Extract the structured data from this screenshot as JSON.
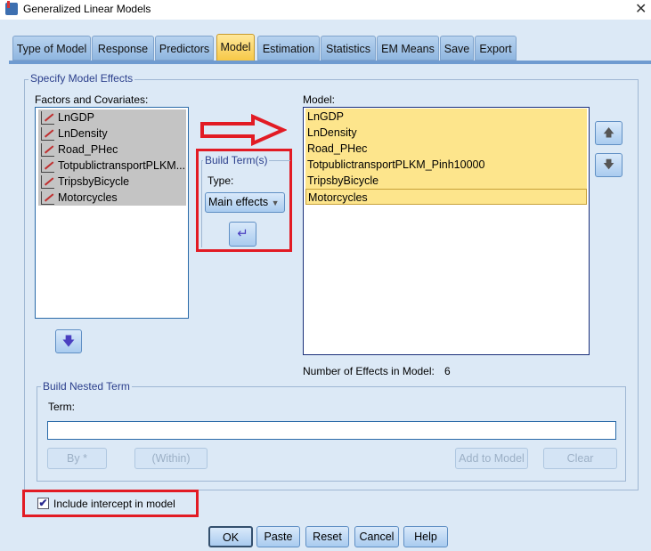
{
  "window": {
    "title": "Generalized Linear Models",
    "close_icon": "close-icon"
  },
  "tabs": [
    {
      "label": "Type of Model"
    },
    {
      "label": "Response"
    },
    {
      "label": "Predictors"
    },
    {
      "label": "Model",
      "active": true
    },
    {
      "label": "Estimation"
    },
    {
      "label": "Statistics"
    },
    {
      "label": "EM Means"
    },
    {
      "label": "Save"
    },
    {
      "label": "Export"
    }
  ],
  "specify": {
    "title": "Specify Model Effects",
    "factors_label": "Factors and Covariates:",
    "factors": [
      "LnGDP",
      "LnDensity",
      "Road_PHec",
      "TotpublictransportPLKM...",
      "TripsbyBicycle",
      "Motorcycles"
    ],
    "model_label": "Model:",
    "model": [
      "LnGDP",
      "LnDensity",
      "Road_PHec",
      "TotpublictransportPLKM_Pinh10000",
      "TripsbyBicycle",
      "Motorcycles"
    ],
    "selected_model_item": "Motorcycles",
    "build_term": {
      "title": "Build Term(s)",
      "type_label": "Type:",
      "type_value": "Main effects"
    },
    "effects_label": "Number of Effects in Model:",
    "effects_count": "6"
  },
  "nested": {
    "title": "Build Nested Term",
    "term_label": "Term:",
    "term_value": "",
    "by": "By *",
    "within": "(Within)",
    "add": "Add to Model",
    "clear": "Clear"
  },
  "intercept": {
    "label": "Include intercept in model",
    "checked": true
  },
  "buttons": {
    "ok": "OK",
    "paste": "Paste",
    "reset": "Reset",
    "cancel": "Cancel",
    "help": "Help"
  },
  "colors": {
    "highlight": "#e21b24",
    "model_item": "#fde58c",
    "active_tab": "#f7c847"
  }
}
